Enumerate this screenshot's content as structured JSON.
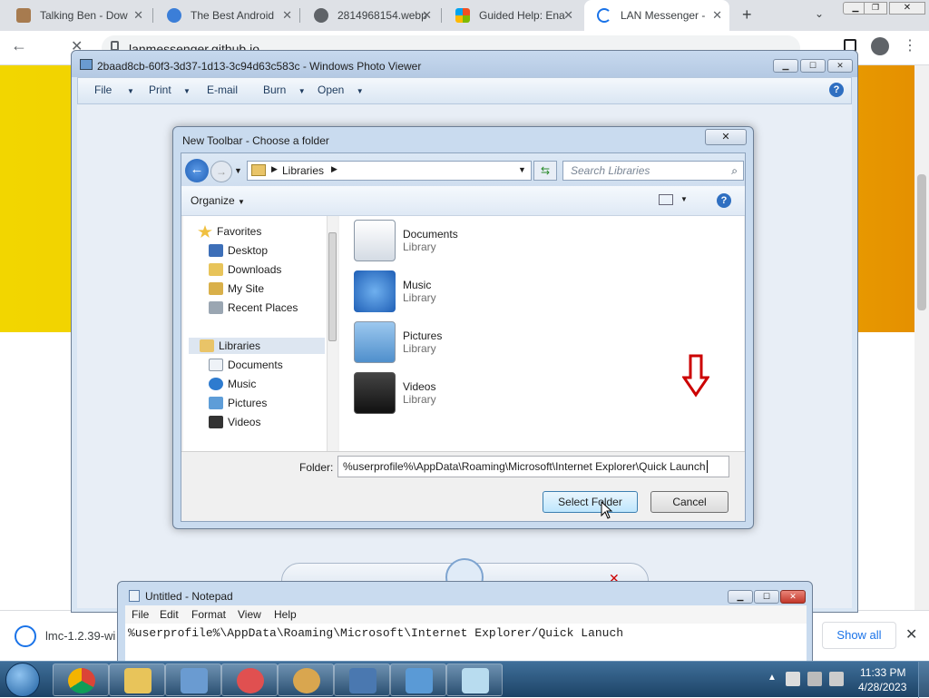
{
  "browser": {
    "tabs": [
      {
        "label": "Talking Ben - Dow"
      },
      {
        "label": "The Best Android"
      },
      {
        "label": "2814968154.webp"
      },
      {
        "label": "Guided Help: Ena"
      },
      {
        "label": "LAN Messenger -"
      }
    ],
    "url": "lanmessenger.github.io",
    "download_file": "lmc-1.2.39-wi",
    "show_all": "Show all"
  },
  "photo_viewer": {
    "title": "2baad8cb-60f3-3d37-1d13-3c94d63c583c - Windows Photo Viewer",
    "menu": [
      "File",
      "Print",
      "E-mail",
      "Burn",
      "Open"
    ]
  },
  "dialog": {
    "title": "New Toolbar - Choose a folder",
    "address": "Libraries",
    "search_placeholder": "Search Libraries",
    "organize": "Organize",
    "nav": {
      "favorites": "Favorites",
      "fav_items": [
        "Desktop",
        "Downloads",
        "My Site",
        "Recent Places"
      ],
      "libraries": "Libraries",
      "lib_items": [
        "Documents",
        "Music",
        "Pictures",
        "Videos"
      ]
    },
    "libraries": [
      {
        "name": "Documents",
        "type": "Library"
      },
      {
        "name": "Music",
        "type": "Library"
      },
      {
        "name": "Pictures",
        "type": "Library"
      },
      {
        "name": "Videos",
        "type": "Library"
      }
    ],
    "folder_label": "Folder:",
    "folder_value": "%userprofile%\\AppData\\Roaming\\Microsoft\\Internet Explorer\\Quick Launch",
    "select_button": "Select Folder",
    "cancel_button": "Cancel"
  },
  "notepad": {
    "title": "Untitled - Notepad",
    "menu": [
      "File",
      "Edit",
      "Format",
      "View",
      "Help"
    ],
    "text": "%userprofile%\\AppData\\Roaming\\Microsoft\\Internet Explorer/Quick Lanuch"
  },
  "taskbar": {
    "time": "11:33 PM",
    "date": "4/28/2023"
  },
  "colors": {
    "annotation_arrow": "#cc0000",
    "page_yellow": "#f2d600"
  }
}
